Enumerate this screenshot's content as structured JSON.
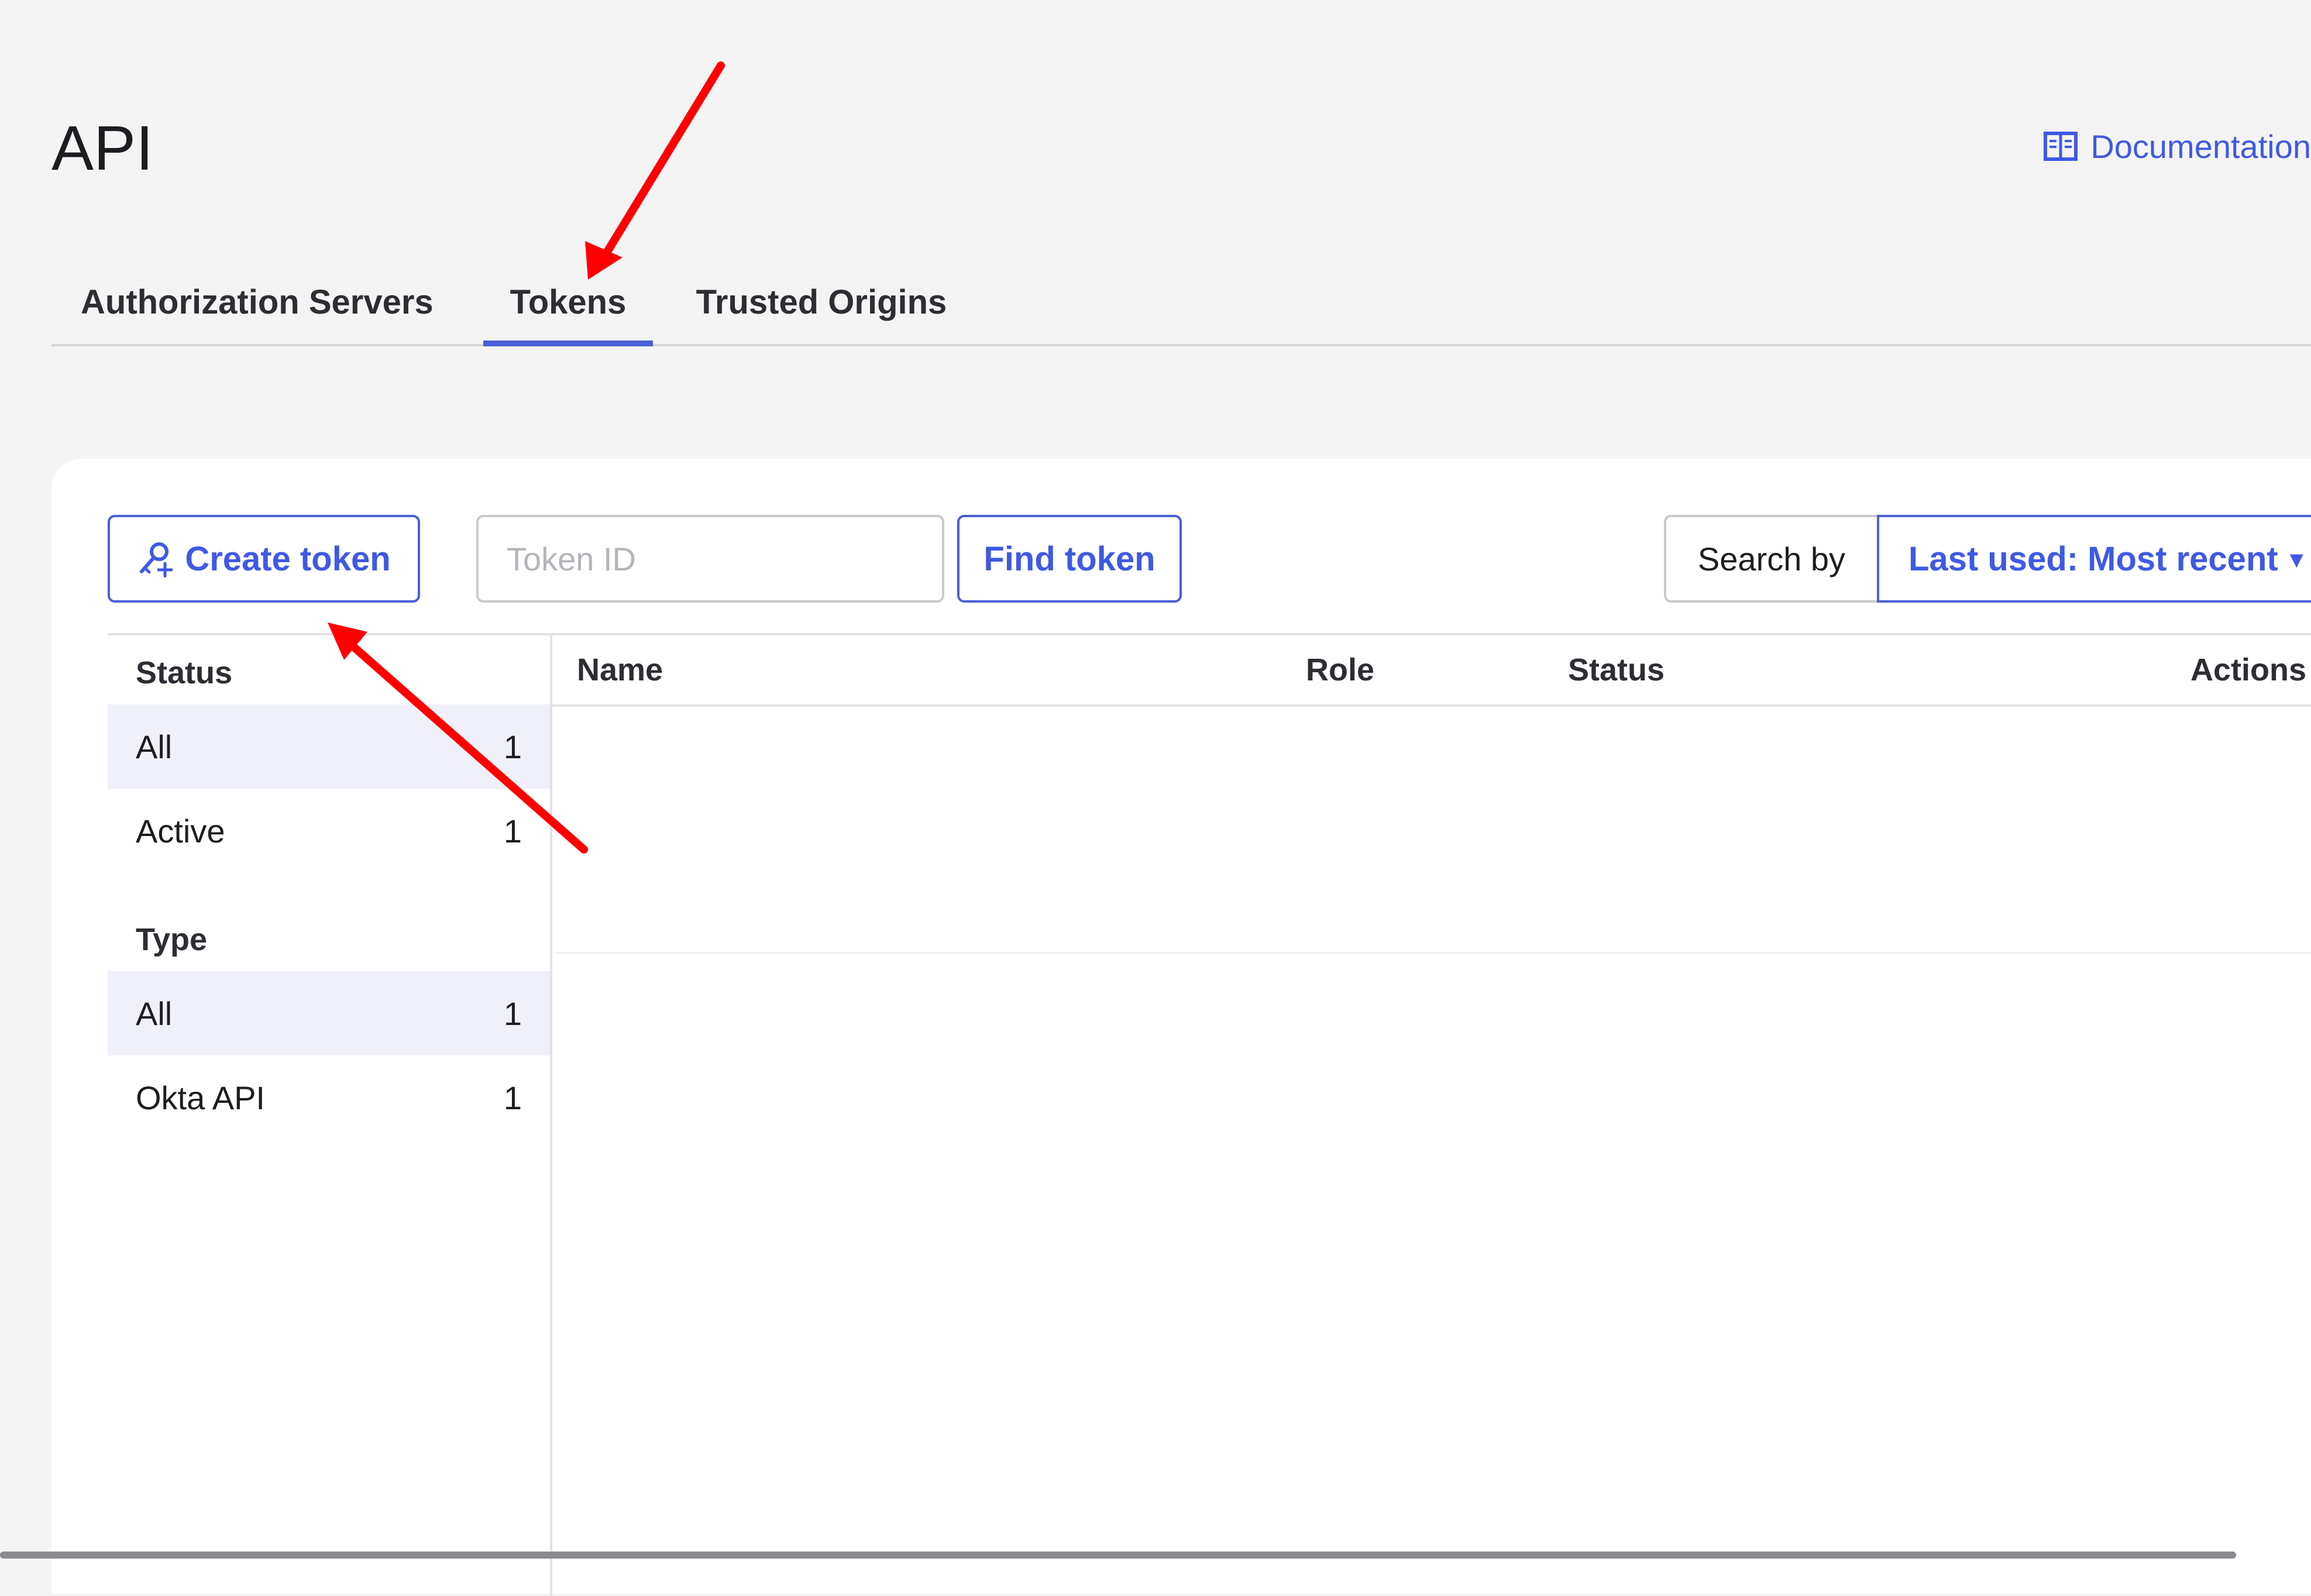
{
  "page": {
    "title": "API",
    "docs_link": "Documentation"
  },
  "tabs": [
    {
      "label": "Authorization Servers",
      "active": false
    },
    {
      "label": "Tokens",
      "active": true
    },
    {
      "label": "Trusted Origins",
      "active": false
    }
  ],
  "toolbar": {
    "create_token_label": "Create token",
    "token_id_placeholder": "Token ID",
    "token_id_value": "",
    "find_token_label": "Find token",
    "search_by_label": "Search by",
    "sort_selected": "Last used: Most recent",
    "caret_glyph": "▾"
  },
  "filters": {
    "status": {
      "heading": "Status",
      "items": [
        {
          "label": "All",
          "count": "1",
          "selected": true
        },
        {
          "label": "Active",
          "count": "1",
          "selected": false
        }
      ]
    },
    "type": {
      "heading": "Type",
      "items": [
        {
          "label": "All",
          "count": "1",
          "selected": true
        },
        {
          "label": "Okta API",
          "count": "1",
          "selected": false
        }
      ]
    }
  },
  "table": {
    "columns": [
      "Name",
      "Role",
      "Status",
      "Actions"
    ],
    "rows": []
  },
  "colors": {
    "accent": "#3f59e4",
    "tab_underline": "#4b5fd6",
    "annotation_arrow": "#ff0000",
    "background": "#f4f4f4",
    "panel": "#ffffff"
  },
  "icons": {
    "docs": "book-icon",
    "create_token": "key-plus-icon",
    "sort": "chevron-down-icon"
  }
}
